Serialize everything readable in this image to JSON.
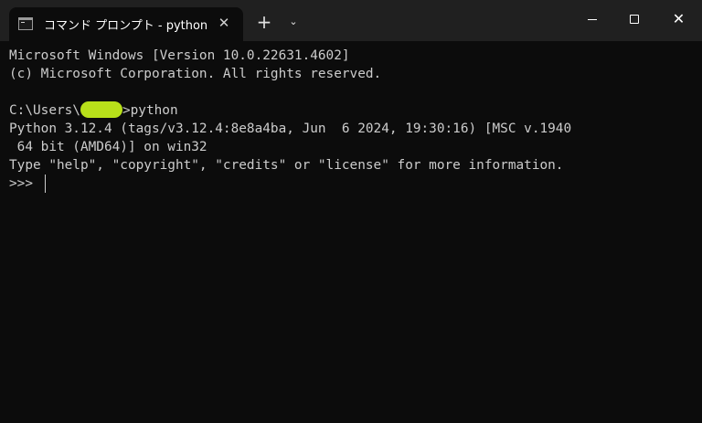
{
  "window": {
    "tab_title": "コマンド プロンプト - python",
    "tab_close_glyph": "✕",
    "new_tab_glyph": "+",
    "dropdown_glyph": "⌄",
    "close_glyph": "✕"
  },
  "terminal": {
    "lines": [
      "Microsoft Windows [Version 10.0.22631.4602]",
      "(c) Microsoft Corporation. All rights reserved.",
      "",
      "",
      "Python 3.12.4 (tags/v3.12.4:8e8a4ba, Jun  6 2024, 19:30:16) [MSC v.1940",
      " 64 bit (AMD64)] on win32",
      "Type \"help\", \"copyright\", \"credits\" or \"license\" for more information.",
      ">>> "
    ],
    "prompt_path": "C:\\Users\\",
    "prompt_command": ">python"
  },
  "colors": {
    "terminal_bg": "#0c0c0c",
    "titlebar_bg": "#202020",
    "text": "#cccccc",
    "redaction": "#b8e01a"
  },
  "icons": {
    "tab": "terminal-icon",
    "tab_close": "close-icon",
    "new_tab": "plus-icon",
    "dropdown": "chevron-down-icon",
    "minimize": "minimize-icon",
    "maximize": "maximize-icon",
    "close": "close-icon"
  }
}
